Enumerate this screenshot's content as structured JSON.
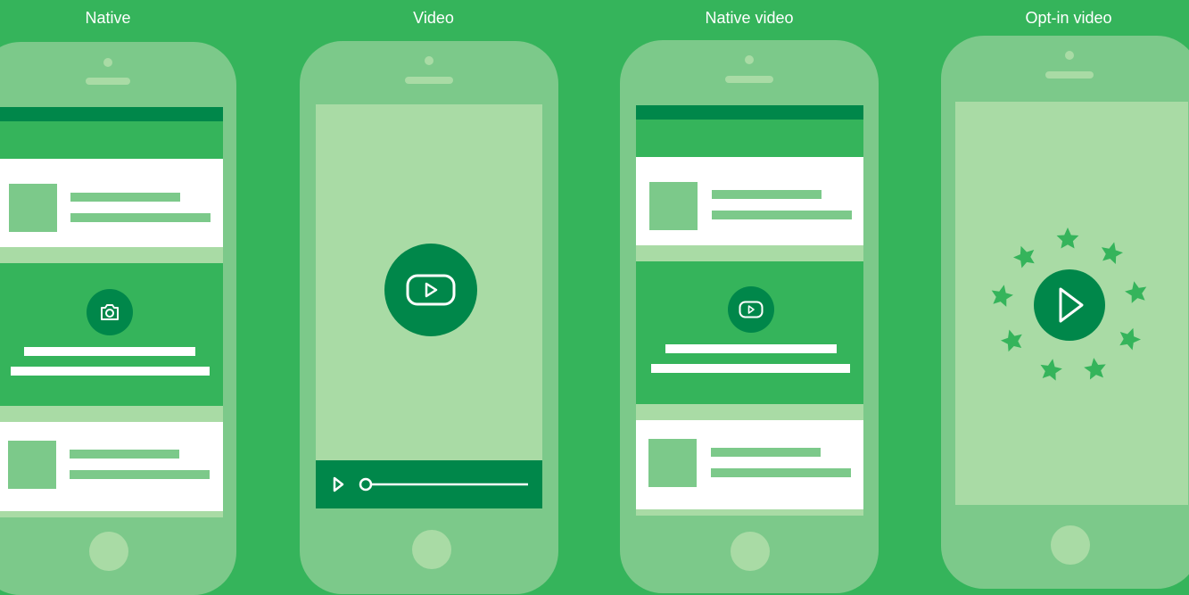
{
  "labels": {
    "native": "Native",
    "video": "Video",
    "native_video": "Native video",
    "opt_in_video": "Opt-in video"
  },
  "colors": {
    "background": "#35b45b",
    "phone_body": "#7cc98a",
    "phone_detail": "#a9dba5",
    "dark_green": "#00874a",
    "card_white": "#ffffff"
  },
  "icons": {
    "native_ad": "camera-icon",
    "video_ad": "play-button-icon",
    "native_video_ad": "play-button-icon",
    "opt_in_video_ad": "play-icon",
    "reward": "star-icon"
  }
}
